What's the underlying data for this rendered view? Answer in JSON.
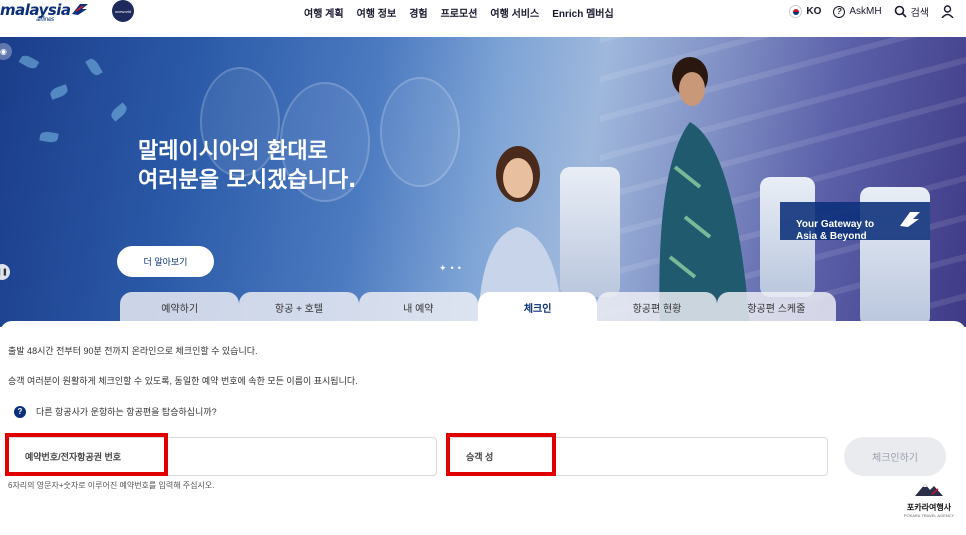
{
  "header": {
    "logo_text": "malaysia",
    "logo_sub": "airlines",
    "oneworld_text": "oneworld",
    "nav": [
      "여행 계획",
      "여행 정보",
      "경험",
      "프로모션",
      "여행 서비스",
      "Enrich 멤버십"
    ],
    "language": "KO",
    "askmh": "AskMH",
    "search": "검색"
  },
  "hero": {
    "title": "말레이시아의 환대로\n여러분을 모시겠습니다.",
    "cta": "더 알아보기",
    "badge": "Your Gateway to\nAsia & Beyond"
  },
  "tabs": [
    {
      "label": "예약하기",
      "active": false
    },
    {
      "label": "항공 + 호텔",
      "active": false
    },
    {
      "label": "내 예약",
      "active": false
    },
    {
      "label": "체크인",
      "active": true
    },
    {
      "label": "항공편 현황",
      "active": false
    },
    {
      "label": "항공편 스케줄",
      "active": false
    }
  ],
  "checkin": {
    "line1": "출발 48시간 전부터 90분 전까지 온라인으로 체크인할 수 있습니다.",
    "line2": "승객 여러분이 원활하게 체크인할 수 있도록, 동일한 예약 번호에 속한 모든 이름이 표시됩니다.",
    "other_airline_q": "다른 항공사가 운항하는 항공편을 탑승하십니까?",
    "booking_field_label": "예약번호/전자항공권 번호",
    "surname_field_label": "승객 성",
    "button": "체크인하기",
    "hint": "6자리의 영문자+숫자로 이루어진 예약번호를 입력해 주십시오."
  },
  "watermark": {
    "name": "포카라여행사",
    "sub": "POKARA TRAVEL AGENCY"
  },
  "colors": {
    "brand_navy": "#0b2f7a",
    "highlight_red": "#e00000"
  }
}
